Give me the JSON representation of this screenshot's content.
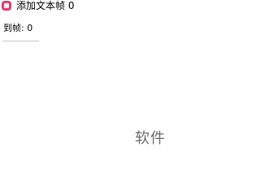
{
  "menu": {
    "add_text_frame": {
      "icon": "add-frame-icon",
      "label": "添加文本帧 0"
    }
  },
  "goto_frame": {
    "label": "到帧: 0"
  },
  "watermark": {
    "text": "软件"
  }
}
